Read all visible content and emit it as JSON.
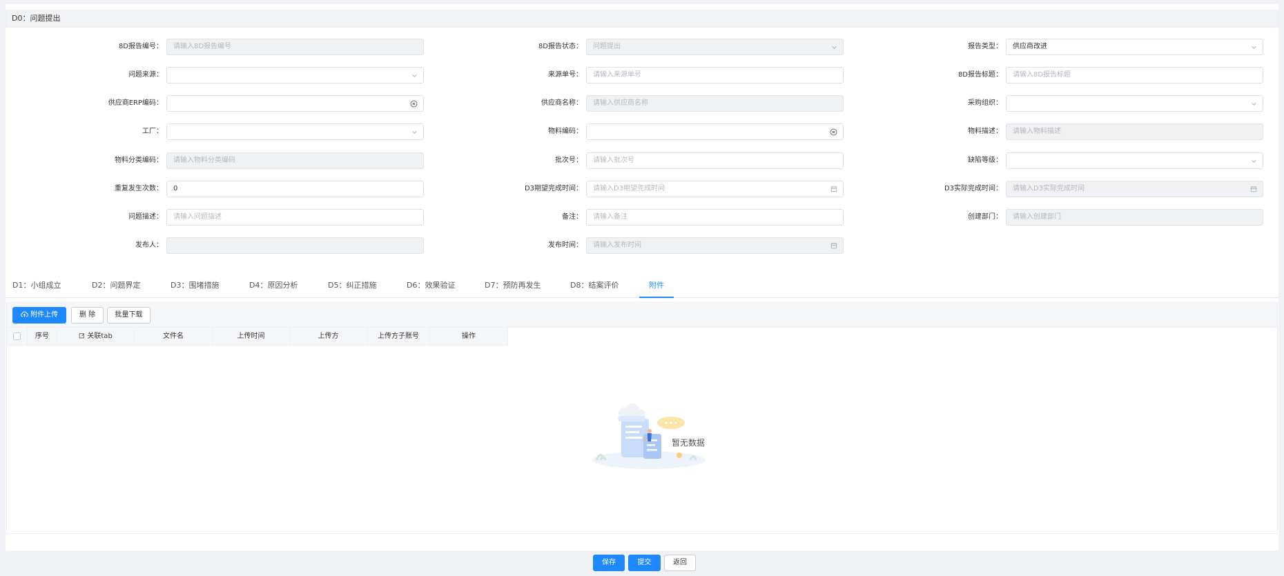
{
  "section": {
    "title": "D0：问题提出"
  },
  "form": {
    "fields": [
      {
        "label": "8D报告编号：",
        "placeholder": "请输入8D报告编号",
        "value": "",
        "disabled": true,
        "suffix": ""
      },
      {
        "label": "8D报告状态：",
        "placeholder": "问题提出",
        "value": "",
        "disabled": true,
        "suffix": "chevron-down-icon"
      },
      {
        "label": "报告类型：",
        "placeholder": "",
        "value": "供应商改进",
        "disabled": false,
        "suffix": "chevron-down-icon"
      },
      {
        "label": "问题来源：",
        "placeholder": "",
        "value": "",
        "disabled": false,
        "suffix": "chevron-down-icon"
      },
      {
        "label": "来源单号：",
        "placeholder": "请输入来源单号",
        "value": "",
        "disabled": false,
        "suffix": ""
      },
      {
        "label": "8D报告标题：",
        "placeholder": "请输入8D报告标题",
        "value": "",
        "disabled": false,
        "suffix": ""
      },
      {
        "label": "供应商ERP编码：",
        "placeholder": "",
        "value": "",
        "disabled": false,
        "suffix": "clear-circle-icon"
      },
      {
        "label": "供应商名称：",
        "placeholder": "请输入供应商名称",
        "value": "",
        "disabled": true,
        "suffix": ""
      },
      {
        "label": "采购组织：",
        "placeholder": "",
        "value": "",
        "disabled": false,
        "suffix": "chevron-down-icon"
      },
      {
        "label": "工厂：",
        "placeholder": "",
        "value": "",
        "disabled": false,
        "suffix": "chevron-down-icon"
      },
      {
        "label": "物料编码：",
        "placeholder": "",
        "value": "",
        "disabled": false,
        "suffix": "clear-circle-icon"
      },
      {
        "label": "物料描述：",
        "placeholder": "请输入物料描述",
        "value": "",
        "disabled": true,
        "suffix": ""
      },
      {
        "label": "物料分类编码：",
        "placeholder": "请输入物料分类编码",
        "value": "",
        "disabled": true,
        "suffix": ""
      },
      {
        "label": "批次号：",
        "placeholder": "请输入批次号",
        "value": "",
        "disabled": false,
        "suffix": ""
      },
      {
        "label": "缺陷等级：",
        "placeholder": "",
        "value": "",
        "disabled": false,
        "suffix": "chevron-down-icon"
      },
      {
        "label": "重复发生次数：",
        "placeholder": "",
        "value": "0",
        "disabled": false,
        "suffix": ""
      },
      {
        "label": "D3期望完成时间：",
        "placeholder": "请输入D3期望完成时间",
        "value": "",
        "disabled": false,
        "suffix": "calendar-icon"
      },
      {
        "label": "D3实际完成时间：",
        "placeholder": "请输入D3实际完成时间",
        "value": "",
        "disabled": true,
        "suffix": "calendar-icon"
      },
      {
        "label": "问题描述：",
        "placeholder": "请输入问题描述",
        "value": "",
        "disabled": false,
        "suffix": ""
      },
      {
        "label": "备注：",
        "placeholder": "请输入备注",
        "value": "",
        "disabled": false,
        "suffix": ""
      },
      {
        "label": "创建部门：",
        "placeholder": "请输入创建部门",
        "value": "",
        "disabled": true,
        "suffix": ""
      },
      {
        "label": "发布人：",
        "placeholder": "",
        "value": "",
        "disabled": true,
        "suffix": ""
      },
      {
        "label": "发布时间：",
        "placeholder": "请输入发布时间",
        "value": "",
        "disabled": true,
        "suffix": "calendar-icon"
      }
    ]
  },
  "tabs": [
    {
      "label": "D1：小组成立",
      "active": false
    },
    {
      "label": "D2：问题界定",
      "active": false
    },
    {
      "label": "D3：围堵措施",
      "active": false
    },
    {
      "label": "D4：原因分析",
      "active": false
    },
    {
      "label": "D5：纠正措施",
      "active": false
    },
    {
      "label": "D6：效果验证",
      "active": false
    },
    {
      "label": "D7：预防再发生",
      "active": false
    },
    {
      "label": "D8：结案评价",
      "active": false
    },
    {
      "label": "附件",
      "active": true
    }
  ],
  "toolbar": {
    "upload_label": "附件上传",
    "delete_label": "删 除",
    "batch_download_label": "批量下载"
  },
  "table": {
    "columns": [
      "序号",
      "关联tab",
      "文件名",
      "上传时间",
      "上传方",
      "上传方子账号",
      "操作"
    ],
    "empty_text": "暂无数据"
  },
  "footer": {
    "save_label": "保存",
    "submit_label": "提交",
    "back_label": "返回"
  },
  "colors": {
    "primary": "#1e88ff",
    "disabled_bg": "#f0f1f3",
    "border": "#dcdfe6"
  }
}
